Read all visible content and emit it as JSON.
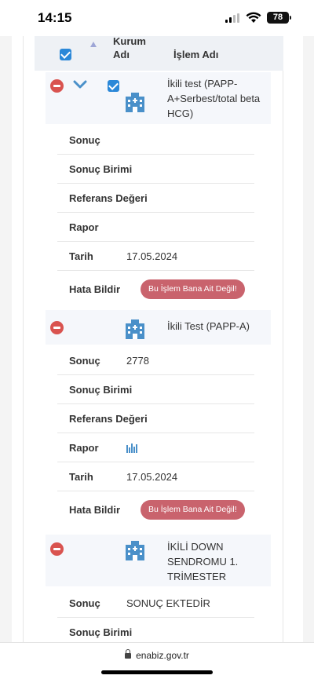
{
  "status_bar": {
    "time": "14:15",
    "battery": "78"
  },
  "table_header": {
    "kurum_line1": "Kurum",
    "kurum_line2": "Adı",
    "islem": "İşlem Adı"
  },
  "records": [
    {
      "title_lines": [
        "İkili test (PAPP-",
        "A+Serbest/total beta",
        "HCG)"
      ],
      "rows": {
        "sonuc_label": "Sonuç",
        "sonuc_value": "",
        "birim_label": "Sonuç Birimi",
        "referans_label": "Referans Değeri",
        "rapor_label": "Rapor",
        "tarih_label": "Tarih",
        "tarih_value": "17.05.2024",
        "hata_label": "Hata Bildir",
        "hata_button": "Bu İşlem Bana Ait Değil!"
      }
    },
    {
      "title_lines": [
        "İkili Test (PAPP-A)"
      ],
      "rows": {
        "sonuc_label": "Sonuç",
        "sonuc_value": "2778",
        "birim_label": "Sonuç Birimi",
        "referans_label": "Referans Değeri",
        "rapor_label": "Rapor",
        "rapor_icon": "bar-chart-icon",
        "tarih_label": "Tarih",
        "tarih_value": "17.05.2024",
        "hata_label": "Hata Bildir",
        "hata_button": "Bu İşlem Bana Ait Değil!"
      }
    },
    {
      "title_lines": [
        "İKİLİ DOWN",
        "SENDROMU 1.",
        "TRİMESTER"
      ],
      "rows": {
        "sonuc_label": "Sonuç",
        "sonuc_value": "SONUÇ EKTEDİR",
        "birim_label": "Sonuç Birimi"
      }
    }
  ],
  "browser": {
    "url": "enabiz.gov.tr"
  },
  "colors": {
    "accent": "#2b88d8",
    "danger": "#d9534f",
    "button": "#c9636d",
    "building": "#4a90c9"
  }
}
